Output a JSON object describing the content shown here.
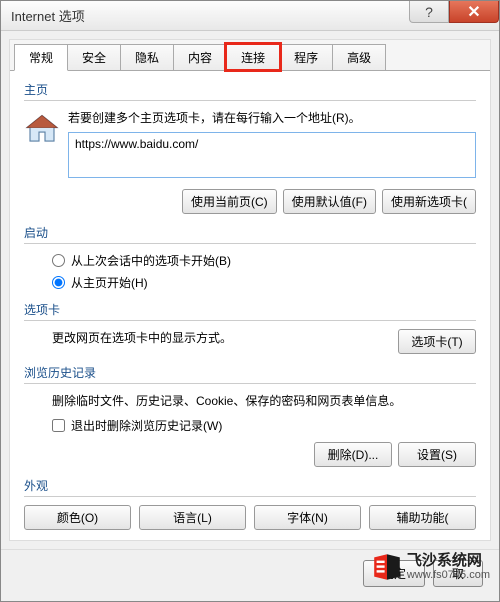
{
  "window": {
    "title": "Internet 选项"
  },
  "tabs": {
    "items": [
      {
        "label": "常规"
      },
      {
        "label": "安全"
      },
      {
        "label": "隐私"
      },
      {
        "label": "内容"
      },
      {
        "label": "连接"
      },
      {
        "label": "程序"
      },
      {
        "label": "高级"
      }
    ]
  },
  "homepage": {
    "title": "主页",
    "label": "若要创建多个主页选项卡，请在每行输入一个地址(R)。",
    "value": "https://www.baidu.com/",
    "buttons": {
      "use_current": "使用当前页(C)",
      "use_default": "使用默认值(F)",
      "use_new_tab": "使用新选项卡("
    }
  },
  "startup": {
    "title": "启动",
    "radio_last_session": "从上次会话中的选项卡开始(B)",
    "radio_home": "从主页开始(H)"
  },
  "tabs_section": {
    "title": "选项卡",
    "desc": "更改网页在选项卡中的显示方式。",
    "button": "选项卡(T)"
  },
  "history": {
    "title": "浏览历史记录",
    "desc": "删除临时文件、历史记录、Cookie、保存的密码和网页表单信息。",
    "checkbox": "退出时删除浏览历史记录(W)",
    "delete_btn": "删除(D)...",
    "settings_btn": "设置(S)"
  },
  "appearance": {
    "title": "外观",
    "colors": "颜色(O)",
    "languages": "语言(L)",
    "fonts": "字体(N)",
    "accessibility": "辅助功能("
  },
  "dialog_buttons": {
    "ok": "确定",
    "cancel": "取"
  },
  "watermark": {
    "title": "飞沙系统网",
    "url": "www.fs0745.com"
  }
}
